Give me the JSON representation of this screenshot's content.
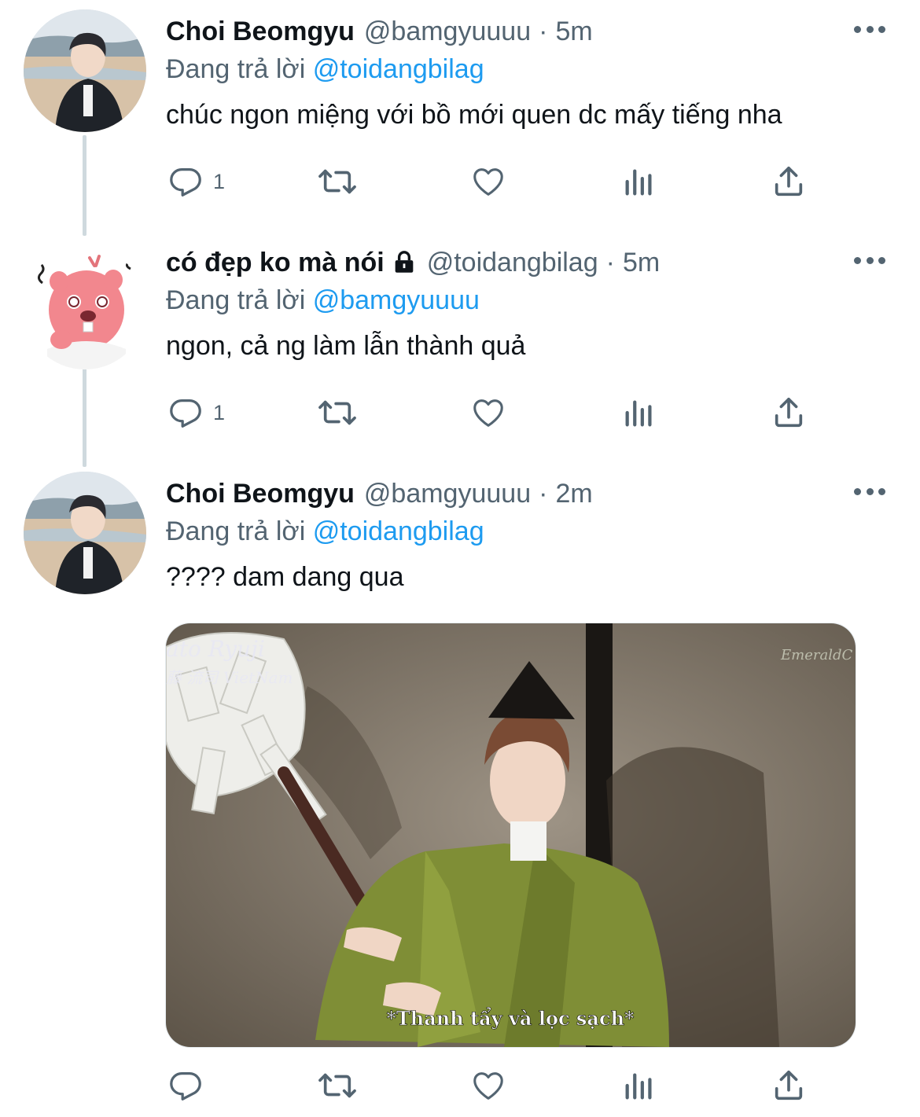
{
  "tweets": [
    {
      "name": "Choi Beomgyu",
      "handle": "@bamgyuuuu",
      "separator": "·",
      "time": "5m",
      "reply_prefix": "Đang trả lời ",
      "reply_mention": "@toidangbilag",
      "text": "chúc ngon miệng với bồ mới quen dc mấy tiếng nha",
      "reply_count": "1"
    },
    {
      "name": "có đẹp ko mà nói",
      "handle": "@toidangbilag",
      "separator": "·",
      "time": "5m",
      "reply_prefix": "Đang trả lời ",
      "reply_mention": "@bamgyuuuu",
      "text": "ngon, cả ng làm lẫn thành quả",
      "reply_count": "1"
    },
    {
      "name": "Choi Beomgyu",
      "handle": "@bamgyuuuu",
      "separator": "·",
      "time": "2m",
      "reply_prefix": "Đang trả lời ",
      "reply_mention": "@toidangbilag",
      "text": "???? dam dang qua",
      "reply_count": ""
    }
  ],
  "media": {
    "watermark_left": "ato Ryuji",
    "watermark_left_sub": "藤 流司 VietNam",
    "watermark_right": "EmeraldC",
    "subtitle": "*Thanh tẩy và lọc sạch*"
  },
  "icons": {
    "reply": "reply-icon",
    "retweet": "retweet-icon",
    "like": "heart-icon",
    "views": "views-icon",
    "share": "share-icon",
    "more": "more-icon",
    "lock": "lock-icon"
  },
  "colors": {
    "text": "#0f1419",
    "secondary": "#536471",
    "link": "#1d9bf0",
    "thread_line": "#cfd9de"
  }
}
